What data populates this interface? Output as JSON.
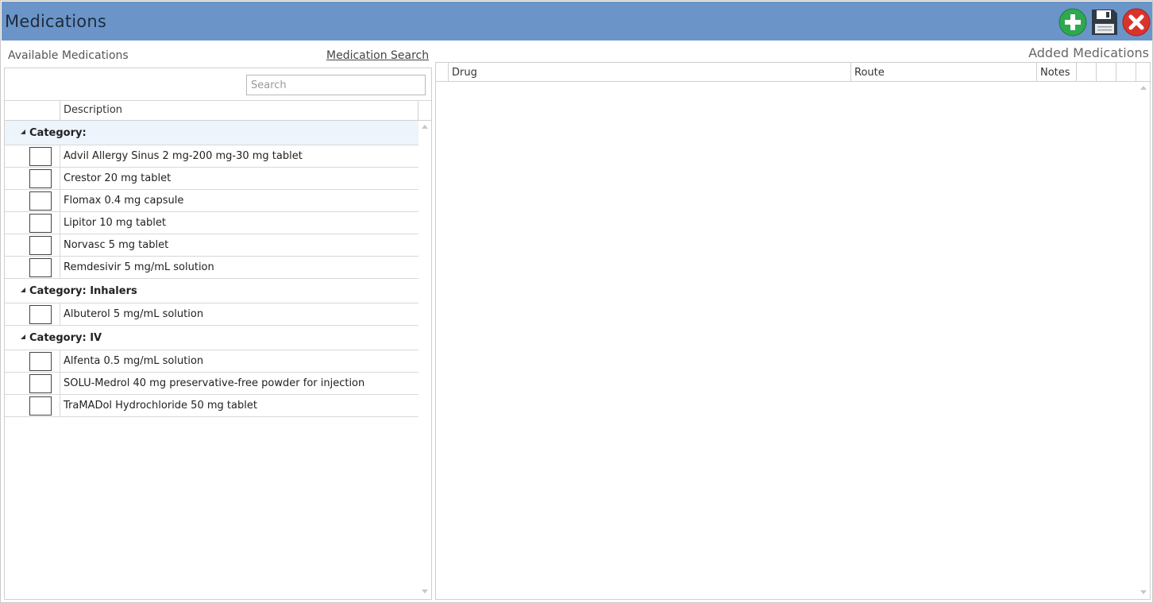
{
  "window": {
    "title": "Medications"
  },
  "toolbar": {
    "add_icon": "plus-circle-icon",
    "save_icon": "floppy-disk-icon",
    "close_icon": "close-circle-icon",
    "colors": {
      "add": "#2fa84f",
      "save": "#2f3a46",
      "close": "#d9342b",
      "titlebar": "#6b95c9"
    }
  },
  "available": {
    "label": "Available Medications",
    "search_link": "Medication Search",
    "search_placeholder": "Search",
    "column_description": "Description",
    "groups": [
      {
        "label": "Category:",
        "items": [
          "Advil Allergy Sinus 2 mg-200 mg-30 mg tablet",
          "Crestor 20 mg tablet",
          "Flomax 0.4 mg capsule",
          "Lipitor 10 mg tablet",
          "Norvasc 5 mg tablet",
          "Remdesivir 5 mg/mL solution"
        ]
      },
      {
        "label": "Category: Inhalers",
        "items": [
          "Albuterol 5 mg/mL solution"
        ]
      },
      {
        "label": "Category: IV",
        "items": [
          "Alfenta 0.5 mg/mL solution",
          "SOLU-Medrol 40 mg preservative-free powder for injection",
          "TraMADol Hydrochloride 50 mg tablet"
        ]
      }
    ]
  },
  "added": {
    "label": "Added Medications",
    "columns": [
      "Drug",
      "Route",
      "Notes",
      "",
      "",
      ""
    ]
  }
}
